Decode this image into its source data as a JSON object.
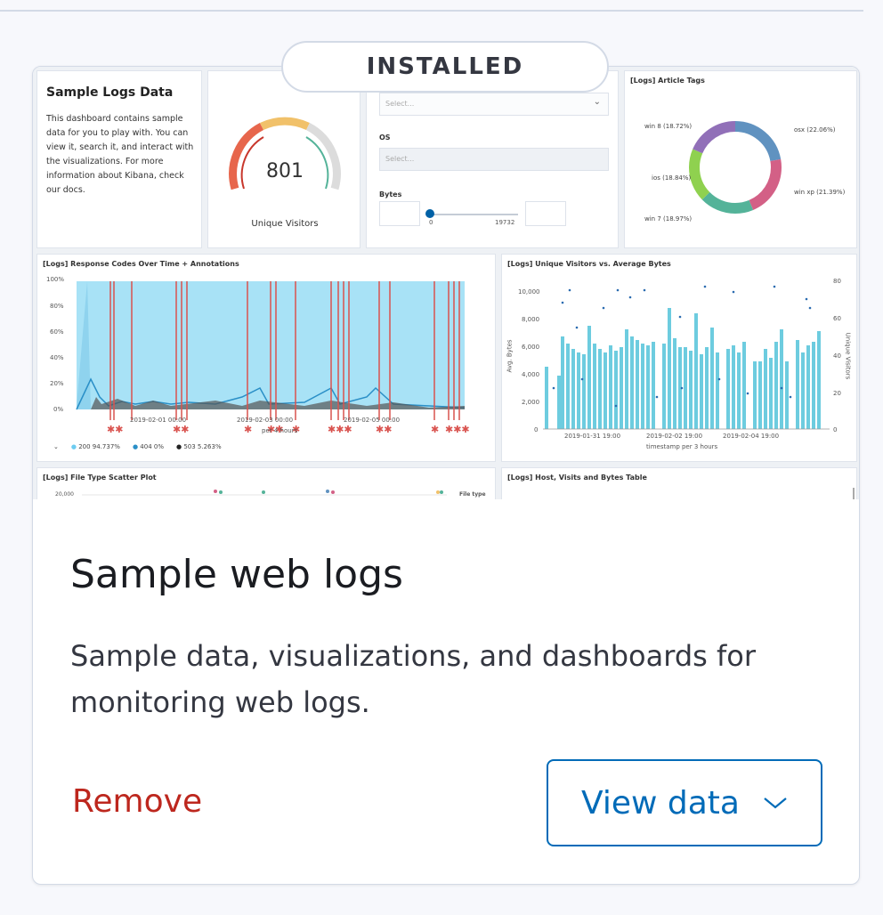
{
  "badge": "INSTALLED",
  "card": {
    "title": "Sample web logs",
    "description": "Sample data, visualizations, and dashboards for monitoring web logs.",
    "remove_label": "Remove",
    "view_label": "View data"
  },
  "preview": {
    "markdown": {
      "title": "Sample Logs Data",
      "body": "This dashboard contains sample data for you to play with. You can view it, search it, and interact with the visualizations. For more information about Kibana, check our docs."
    },
    "gauge": {
      "value": "801",
      "label": "Unique Visitors"
    },
    "controls": {
      "select_placeholder": "Select...",
      "os_label": "OS",
      "os_placeholder": "Select...",
      "bytes_label": "Bytes",
      "range_min": "0",
      "range_max": "19732"
    },
    "tags": {
      "title": "[Logs] Article Tags",
      "labels": [
        "win 8 (18.72%)",
        "osx (22.06%)",
        "ios (18.84%)",
        "win xp (21.39%)",
        "win 7 (18.97%)"
      ]
    },
    "response": {
      "title": "[Logs] Response Codes Over Time + Annotations",
      "yticks": [
        "100%",
        "80%",
        "60%",
        "40%",
        "20%",
        "0%"
      ],
      "xticks": [
        "2019-02-01 00:00",
        "2019-02-03 00:00",
        "2019-02-05 00:00"
      ],
      "per_label": "per 4 hours",
      "legend": [
        "200 94.737%",
        "404 0%",
        "503 5.263%"
      ]
    },
    "visitors": {
      "title": "[Logs] Unique Visitors vs. Average Bytes",
      "ylabel_left": "Avg. Bytes",
      "ylabel_right": "Unique Visitors",
      "yticks_left": [
        "10,000",
        "8,000",
        "6,000",
        "4,000",
        "2,000",
        "0"
      ],
      "yticks_right": [
        "80",
        "60",
        "40",
        "20",
        "0"
      ],
      "xticks": [
        "2019-01-31 19:00",
        "2019-02-02 19:00",
        "2019-02-04 19:00"
      ],
      "xlabel": "timestamp per 3 hours"
    },
    "scatter": {
      "title": "[Logs] File Type Scatter Plot",
      "ytick": "20,000",
      "legend_title": "File type"
    },
    "table": {
      "title": "[Logs] Host, Visits and Bytes Table"
    }
  }
}
